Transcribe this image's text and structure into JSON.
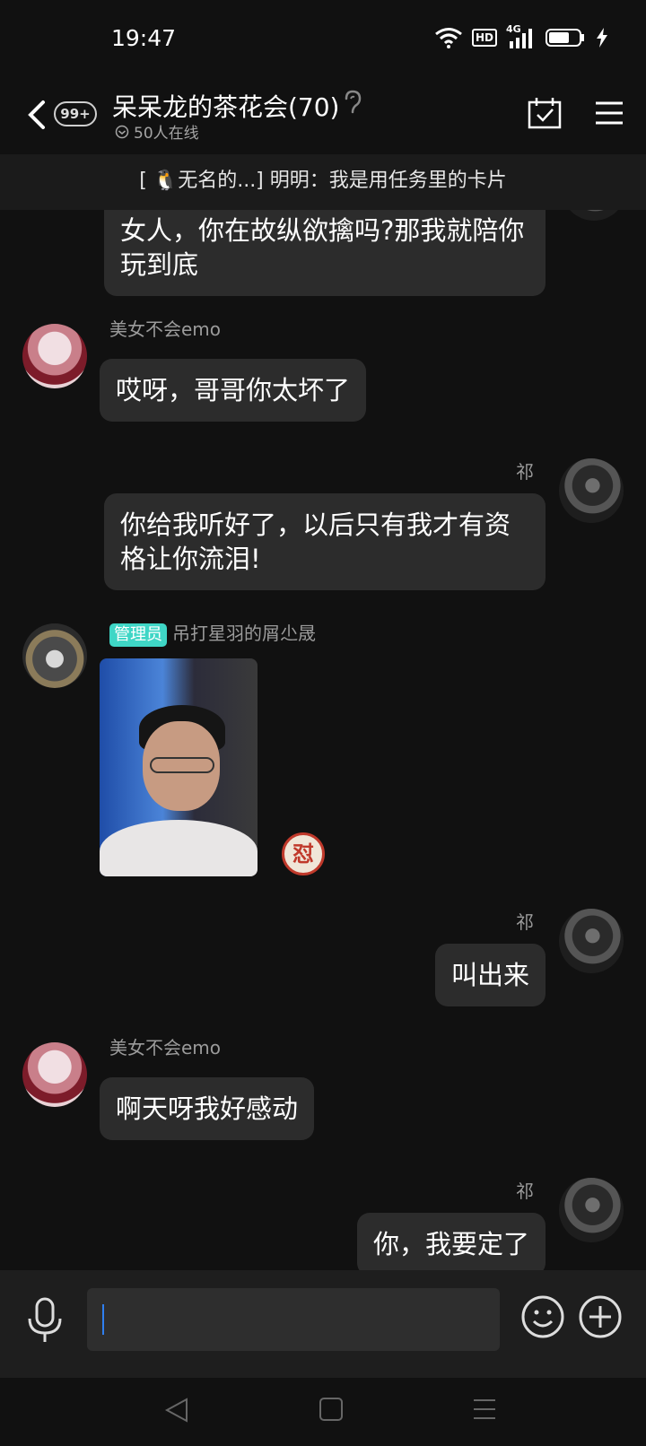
{
  "status_bar": {
    "time": "19:47",
    "network": "4G",
    "hd": "HD"
  },
  "header": {
    "unread_badge": "99+",
    "title": "呆呆龙的茶花会(70)",
    "online": "50人在线"
  },
  "notice": {
    "text": "[ 🐧无名的...] 明明：我是用任务里的卡片"
  },
  "messages": [
    {
      "side": "right",
      "text": "女人，你在故纵欲擒吗?那我就陪你玩到底"
    },
    {
      "side": "left",
      "sender": "美女不会emo",
      "text": "哎呀，哥哥你太坏了"
    },
    {
      "side": "right",
      "sender": "祁",
      "text": "你给我听好了，以后只有我才有资格让你流泪!"
    },
    {
      "side": "left",
      "role_tag": "管理员",
      "sender": "吊打星羽的屑尐晟",
      "reaction": "怼"
    },
    {
      "side": "right",
      "sender": "祁",
      "text": "叫出来"
    },
    {
      "side": "left",
      "sender": "美女不会emo",
      "text": "啊天呀我好感动"
    },
    {
      "side": "right",
      "sender": "祁",
      "text": "你，我要定了"
    }
  ],
  "colors": {
    "background": "#111111",
    "bubble": "#2c2c2c",
    "admin_tag": "#3fd6c6",
    "caret": "#2f7ff0"
  }
}
